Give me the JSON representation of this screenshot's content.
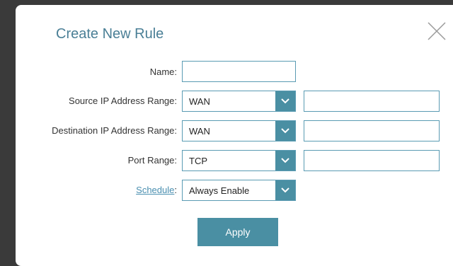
{
  "dialog": {
    "title": "Create New Rule",
    "close_icon": "close-icon"
  },
  "fields": {
    "name": {
      "label": "Name:",
      "value": ""
    },
    "source_ip": {
      "label": "Source IP Address Range:",
      "select_value": "WAN",
      "input_value": ""
    },
    "destination_ip": {
      "label": "Destination IP Address Range:",
      "select_value": "WAN",
      "input_value": ""
    },
    "port_range": {
      "label": "Port Range:",
      "select_value": "TCP",
      "input_value": ""
    },
    "schedule": {
      "label": "Schedule",
      "colon": ":",
      "select_value": "Always Enable"
    }
  },
  "apply_label": "Apply",
  "colors": {
    "accent": "#4a8fa3",
    "title": "#4a7f96",
    "border": "#5a9bb3",
    "link": "#4a8fb0"
  }
}
